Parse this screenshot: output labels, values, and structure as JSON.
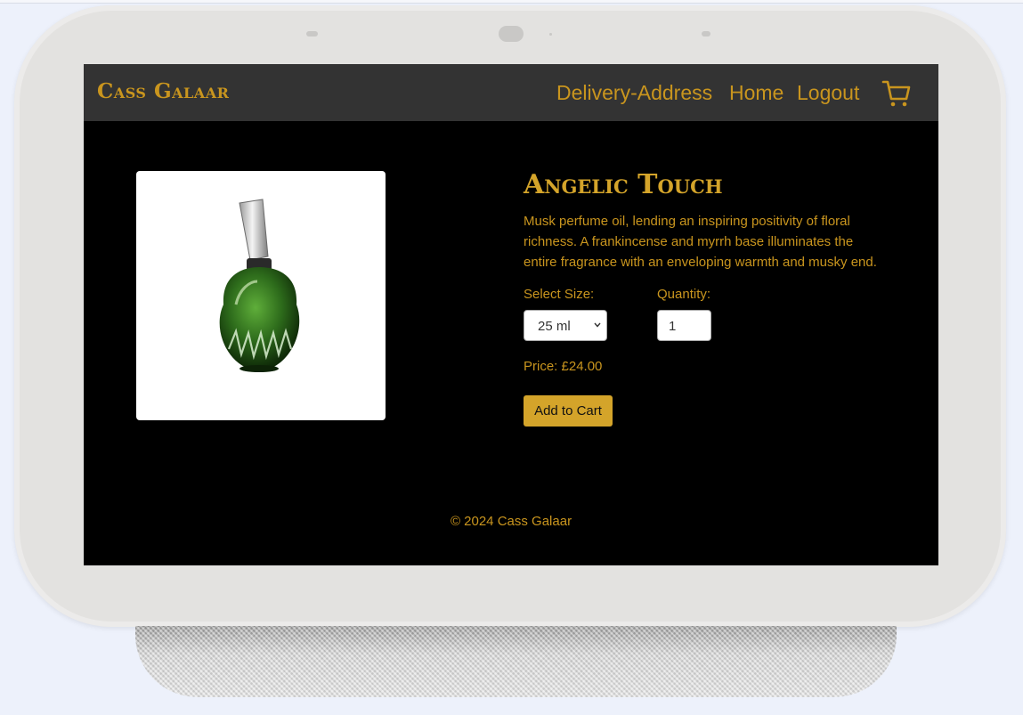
{
  "header": {
    "brand": "Cass Galaar",
    "nav": [
      "Delivery-Address",
      "Home",
      "Logout"
    ],
    "cart_icon": "shopping-cart-icon"
  },
  "product": {
    "title": "Angelic Touch",
    "description": "Musk perfume oil, lending an inspiring positivity of floral richness. A frankincense and myrrh base illuminates the entire fragrance with an enveloping warmth and musky end.",
    "size_label": "Select Size:",
    "size_value": "25 ml",
    "quantity_label": "Quantity:",
    "quantity_value": "1",
    "price": "Price: £24.00",
    "add_button": "Add to Cart"
  },
  "footer": {
    "copyright": "© 2024 Cass Galaar"
  },
  "colors": {
    "accent": "#c9951e",
    "button": "#d4a42a",
    "nav_bg": "#333333",
    "screen_bg": "#000000"
  }
}
